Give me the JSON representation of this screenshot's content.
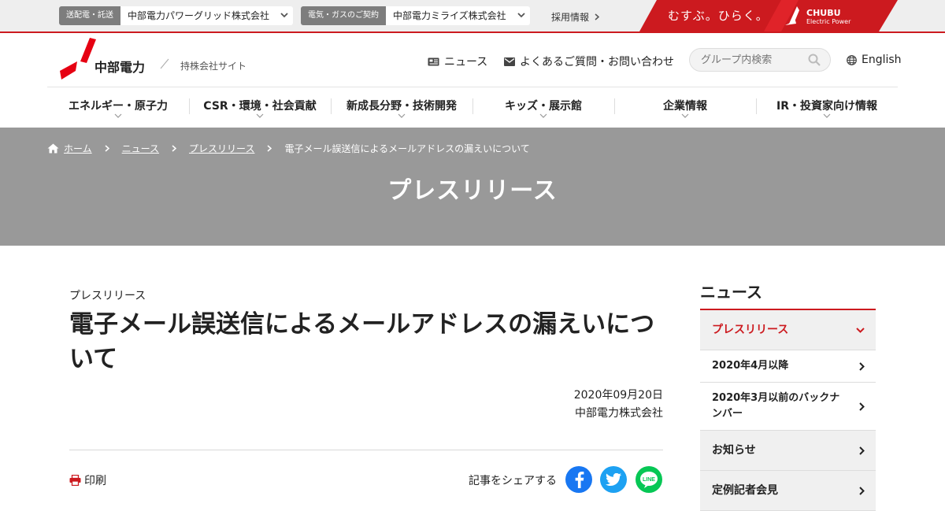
{
  "topbar": {
    "selector1": {
      "tag": "送配電・託送",
      "name": "中部電力パワーグリッド株式会社"
    },
    "selector2": {
      "tag": "電気・ガスのご契約",
      "name": "中部電力ミライズ株式会社"
    },
    "recruit": "採用情報",
    "banner": {
      "slogan": "むすぶ。ひらく。",
      "brand": "CHUBU",
      "brand_sub": "Electric Power"
    }
  },
  "header": {
    "logo_text": "中部電力",
    "logo_sub": "持株会社サイト",
    "news_link": "ニュース",
    "faq_link": "よくあるご質問・お問い合わせ",
    "search_placeholder": "グループ内検索",
    "lang_link": "English"
  },
  "gnav": [
    "エネルギー・原子力",
    "CSR・環境・社会貢献",
    "新成長分野・技術開発",
    "キッズ・展示館",
    "企業情報",
    "IR・投資家向け情報"
  ],
  "breadcrumb": {
    "home": "ホーム",
    "news": "ニュース",
    "press": "プレスリリース",
    "current": "電子メール誤送信によるメールアドレスの漏えいについて"
  },
  "hero": {
    "title": "プレスリリース"
  },
  "article": {
    "category": "プレスリリース",
    "title": "電子メール誤送信によるメールアドレスの漏えいについて",
    "date": "2020年09月20日",
    "company": "中部電力株式会社",
    "print_label": "印刷",
    "share_label": "記事をシェアする"
  },
  "sidebar": {
    "heading": "ニュース",
    "items": [
      {
        "label": "プレスリリース"
      },
      {
        "label": "2020年4月以降"
      },
      {
        "label": "2020年3月以前のバックナンバー"
      },
      {
        "label": "お知らせ"
      },
      {
        "label": "定例記者会見"
      }
    ]
  },
  "colors": {
    "accent": "#cc1a1f",
    "hero_bg": "#999999",
    "facebook": "#1877f2",
    "twitter": "#1da1f2",
    "line": "#06c755"
  },
  "icons": [
    "chevron-down-icon",
    "chevron-right-icon",
    "news-icon",
    "mail-icon",
    "search-icon",
    "globe-icon",
    "home-icon",
    "print-icon",
    "facebook-icon",
    "twitter-icon",
    "line-icon"
  ]
}
